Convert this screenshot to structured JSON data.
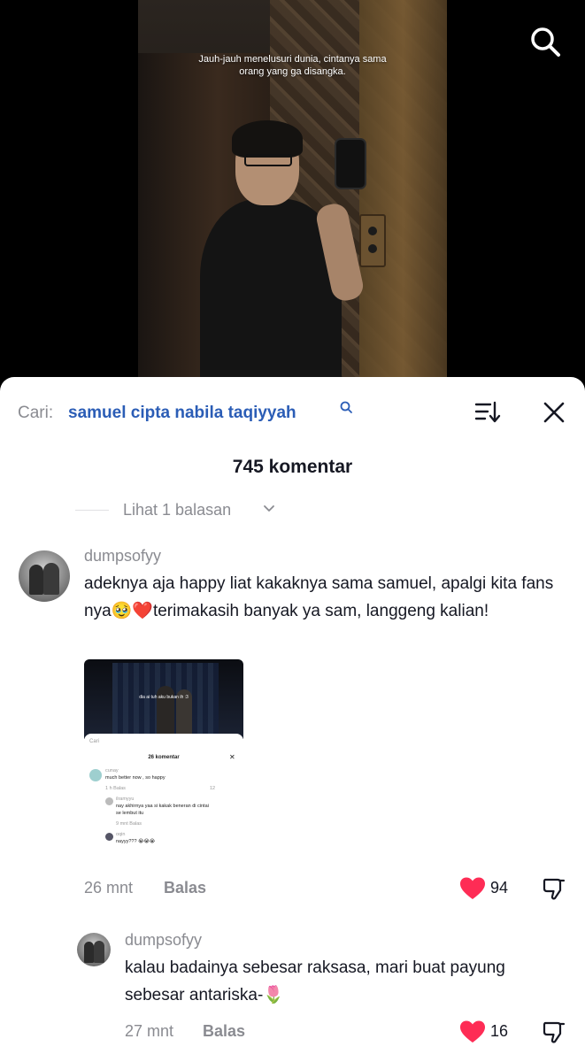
{
  "video": {
    "caption_line1": "Jauh-jauh menelusuri dunia, cintanya sama",
    "caption_line2": "orang yang ga disangka."
  },
  "sheet": {
    "search_prefix": "Cari:",
    "search_term": "samuel cipta nabila taqiyyah",
    "comment_count": "745 komentar",
    "view_replies": "Lihat 1 balasan"
  },
  "comment": {
    "username": "dumpsofyy",
    "text": "adeknya aja happy liat kakaknya sama samuel, apalgi kita fans nya🥹❤️terimakasih banyak ya sam, langgeng kalian!",
    "time": "26 mnt",
    "reply_label": "Balas",
    "likes": "94",
    "attachment": {
      "video_caption": "dia ai tuh aku bukan ih :3",
      "search": "Cari",
      "title": "26 komentar",
      "c1_user": "cunay",
      "c1_text": "much better now , so happy",
      "c1_meta": "1 h   Balas",
      "c1_likes": "12",
      "c2_user": "ilramyyu",
      "c2_text_1": "nay akhirnya yaa si kakak beneran di cintai",
      "c2_text_2": "se lembut itu",
      "c2_meta": "9 mnt   Balas",
      "c3_user": "oqin",
      "c3_text": "nayyy??? 😭😭😭"
    }
  },
  "reply": {
    "username": "dumpsofyy",
    "text": "kalau badainya sebesar raksasa, mari buat payung sebesar antariska-🌷",
    "time": "27 mnt",
    "reply_label": "Balas",
    "likes": "16"
  },
  "colors": {
    "link_blue": "#2b5db6",
    "like_red": "#fe2c55",
    "muted_gray": "#8a8b91",
    "text_dark": "#161823"
  },
  "icons": [
    "search-icon",
    "sort-icon",
    "close-icon",
    "chevron-down-icon",
    "heart-icon",
    "dislike-icon"
  ]
}
